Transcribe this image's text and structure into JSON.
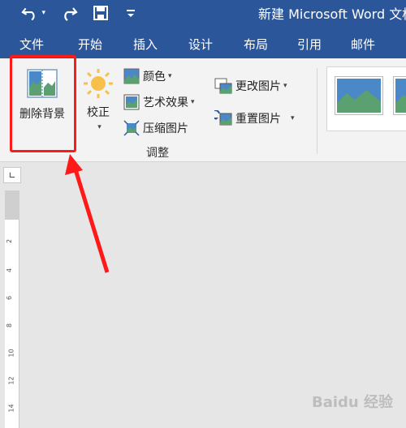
{
  "title": "新建 Microsoft Word 文档",
  "quick_access": {
    "undo_icon": "undo-icon",
    "redo_icon": "redo-icon",
    "save_icon": "save-icon"
  },
  "tabs": [
    "文件",
    "开始",
    "插入",
    "设计",
    "布局",
    "引用",
    "邮件"
  ],
  "ribbon": {
    "remove_bg_label": "删除背景",
    "correct_label": "校正",
    "color_label": "颜色",
    "artistic_label": "艺术效果",
    "compress_label": "压缩图片",
    "change_label": "更改图片",
    "reset_label": "重置图片",
    "group_label": "调整"
  },
  "ruler_ticks": [
    "2",
    "4",
    "6",
    "8",
    "10",
    "12",
    "14"
  ],
  "watermark": "Baidu 经验",
  "colors": {
    "brand": "#2b579a",
    "highlight": "#ff1a1a"
  }
}
